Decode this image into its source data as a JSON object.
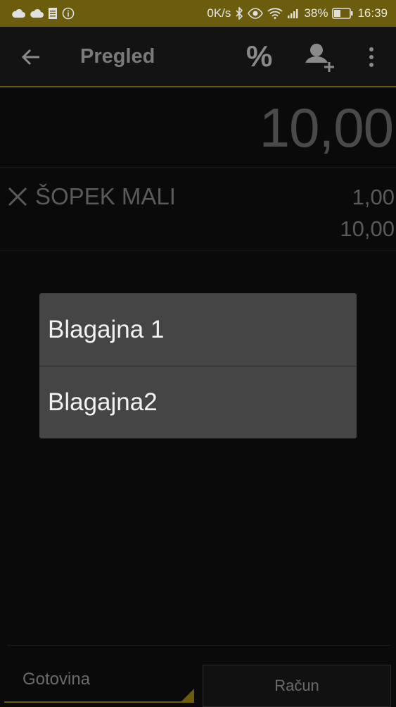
{
  "status_bar": {
    "speed": "0K/s",
    "battery": "38%",
    "time": "16:39"
  },
  "app_bar": {
    "title": "Pregled",
    "discount_label": "%"
  },
  "receipt": {
    "total": "10,00",
    "items": [
      {
        "name": "ŠOPEK MALI",
        "quantity": "1,00",
        "price": "10,00"
      }
    ]
  },
  "dialog": {
    "options": [
      "Blagajna 1",
      "Blagajna2"
    ]
  },
  "footer": {
    "payment_method": "Gotovina",
    "invoice_button": "Račun"
  },
  "colors": {
    "accent": "#6b5c0e",
    "dialog_bg": "#454545",
    "background": "#0a0a0a"
  }
}
